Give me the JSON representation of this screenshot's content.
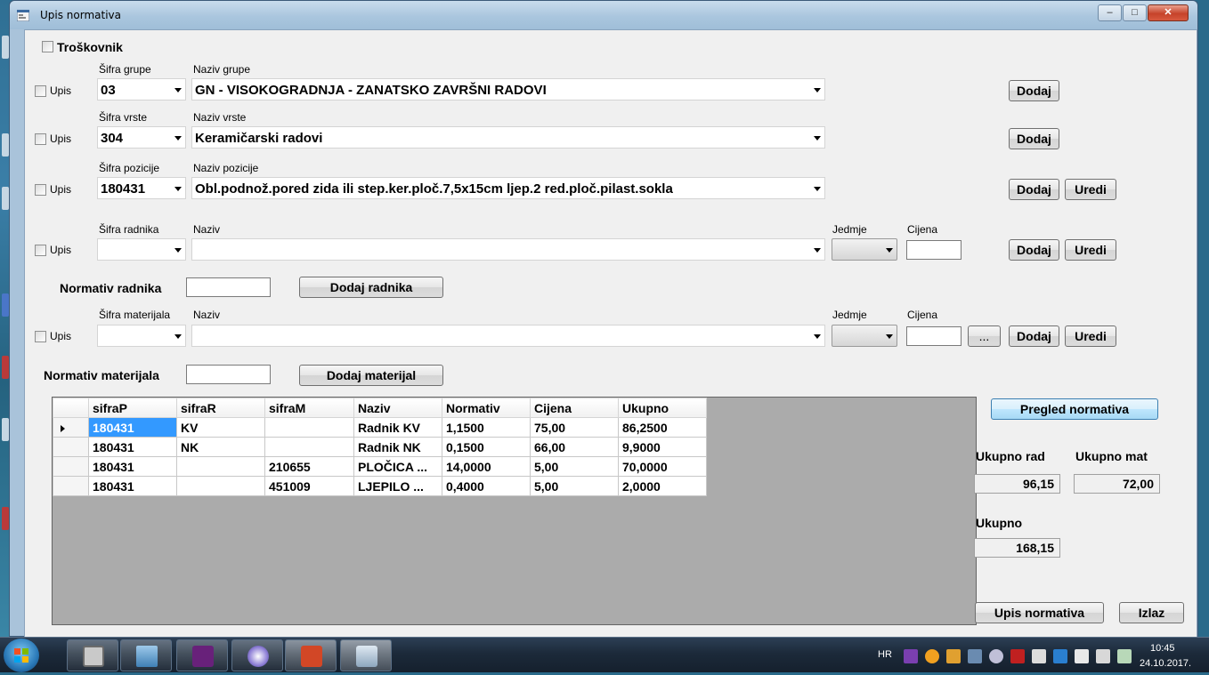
{
  "window": {
    "title": "Upis normativa",
    "caption_minimize": "–",
    "caption_maximize": "□",
    "caption_close": "✕"
  },
  "form": {
    "troskovnik_label": "Troškovnik",
    "upis_label": "Upis",
    "grupa": {
      "sifra_label": "Šifra grupe",
      "sifra_value": "03",
      "naziv_label": "Naziv grupe",
      "naziv_value": "GN - VISOKOGRADNJA - ZANATSKO ZAVRŠNI RADOVI"
    },
    "vrsta": {
      "sifra_label": "Šifra vrste",
      "sifra_value": "304",
      "naziv_label": "Naziv vrste",
      "naziv_value": "Keramičarski radovi"
    },
    "pozicija": {
      "sifra_label": "Šifra pozicije",
      "sifra_value": "180431",
      "naziv_label": "Naziv pozicije",
      "naziv_value": "Obl.podnož.pored zida ili step.ker.ploč.7,5x15cm ljep.2 red.ploč.pilast.sokla"
    },
    "radnik": {
      "sifra_label": "Šifra radnika",
      "naziv_label": "Naziv",
      "jedmje_label": "Jedmje",
      "cijena_label": "Cijena"
    },
    "materijal": {
      "sifra_label": "Šifra materijala",
      "naziv_label": "Naziv",
      "jedmje_label": "Jedmje",
      "cijena_label": "Cijena"
    },
    "normativ_radnika_label": "Normativ radnika",
    "normativ_materijala_label": "Normativ materijala"
  },
  "buttons": {
    "dodaj": "Dodaj",
    "uredi": "Uredi",
    "ellipsis": "...",
    "dodaj_radnika": "Dodaj radnika",
    "dodaj_materijal": "Dodaj materijal",
    "pregled_normativa": "Pregled normativa",
    "upis_normativa": "Upis normativa",
    "izlaz": "Izlaz"
  },
  "grid": {
    "columns": [
      "sifraP",
      "sifraR",
      "sifraM",
      "Naziv",
      "Normativ",
      "Cijena",
      "Ukupno"
    ],
    "rows": [
      [
        "180431",
        "KV",
        "",
        "Radnik KV",
        "1,1500",
        "75,00",
        "86,2500"
      ],
      [
        "180431",
        "NK",
        "",
        "Radnik NK",
        "0,1500",
        "66,00",
        "9,9000"
      ],
      [
        "180431",
        "",
        "210655",
        "PLOČICA ...",
        "14,0000",
        "5,00",
        "70,0000"
      ],
      [
        "180431",
        "",
        "451009",
        "LJEPILO ...",
        "0,4000",
        "5,00",
        "2,0000"
      ]
    ]
  },
  "totals": {
    "ukupno_rad_label": "Ukupno rad",
    "ukupno_rad_value": "96,15",
    "ukupno_mat_label": "Ukupno mat",
    "ukupno_mat_value": "72,00",
    "ukupno_label": "Ukupno",
    "ukupno_value": "168,15"
  },
  "taskbar": {
    "language": "HR",
    "time": "10:45",
    "date": "24.10.2017.",
    "apps": [
      "file-manager-icon",
      "network-computer-icon",
      "visual-studio-icon",
      "media-player-icon",
      "powerpoint-icon",
      "application-icon"
    ]
  },
  "colors": {
    "selection": "#3399ff",
    "grid_background": "#ababab",
    "form_background": "#f0f0f0",
    "window_frame": "#a9c3da"
  }
}
